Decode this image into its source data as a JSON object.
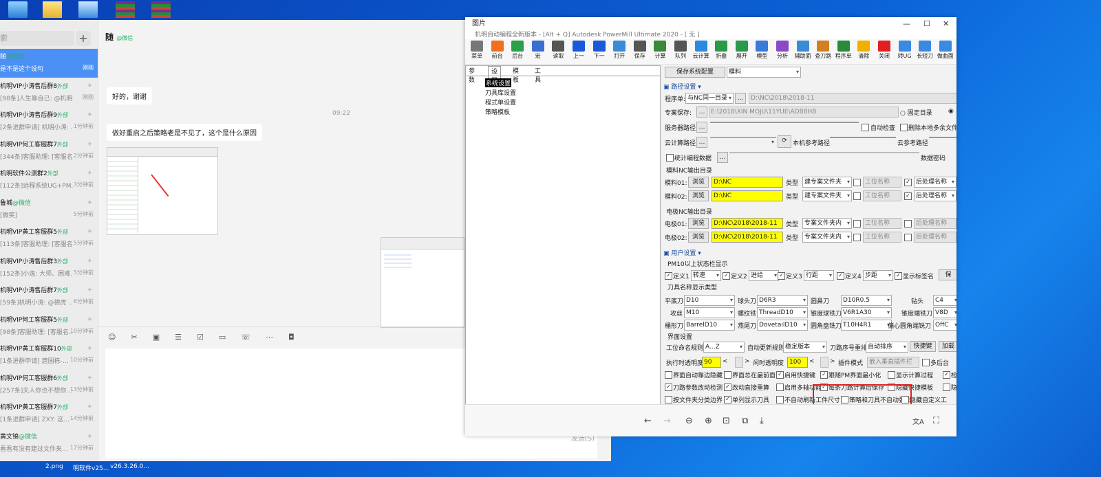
{
  "chat": {
    "search_placeholder": "索",
    "add": "+",
    "header_name": "随",
    "header_tag": "@微信",
    "conversations": [
      {
        "name": "随",
        "tag": "@微信",
        "preview": "是不是这个设句",
        "time": "刚刚",
        "active": true
      },
      {
        "name": "机明VIP小涛售后群8",
        "tag": "外部",
        "preview": "[98条]人生靠自己: @机明小…",
        "time": "刚刚"
      },
      {
        "name": "机明VIP小涛售后群9",
        "tag": "外部",
        "preview": "[2条进群申请] 机明小涛: …",
        "time": "1分钟前",
        "redpre": true
      },
      {
        "name": "机明VIP何工客服群7",
        "tag": "外部",
        "preview": "[344条]客服助理: [客服名…",
        "time": "2分钟前"
      },
      {
        "name": "机明软件公测群2",
        "tag": "外部",
        "preview": "[112条]远程系统UG+PM…",
        "time": "3分钟前"
      },
      {
        "name": "鲁城",
        "tag": "@微信",
        "preview": "[微笑]",
        "time": "5分钟前"
      },
      {
        "name": "机明VIP黄工客服群5",
        "tag": "外部",
        "preview": "[113条]客服助理: [客服名…",
        "time": "5分钟前"
      },
      {
        "name": "机明VIP小涛售后群3",
        "tag": "外部",
        "preview": "[152条]小逸: 大师、困难…",
        "time": "5分钟前"
      },
      {
        "name": "机明VIP小涛售后群7",
        "tag": "外部",
        "preview": "[59条]机明小涛: @德虎 …",
        "time": "6分钟前"
      },
      {
        "name": "机明VIP何工客服群5",
        "tag": "外部",
        "preview": "[98条]客服助理: [客服名…",
        "time": "10分钟前"
      },
      {
        "name": "机明VIP黄工客服群10",
        "tag": "外部",
        "preview": "[1条进群申请] 唐国栋-…",
        "time": "10分钟前",
        "redpre": true
      },
      {
        "name": "机明VIP何工客服群6",
        "tag": "外部",
        "preview": "[257条]夫人你也不想你…",
        "time": "13分钟前"
      },
      {
        "name": "机明VIP黄工客服群7",
        "tag": "外部",
        "preview": "[1条进群申请] ZXY: 这…",
        "time": "14分钟前",
        "redpre": true
      },
      {
        "name": "黄文锦",
        "tag": "@微信",
        "preview": "看看有没有建过文件夹…",
        "time": "17分钟前"
      }
    ],
    "messages": {
      "m1": "好的，谢谢",
      "time": "09:22",
      "m2": "做好重启之后策略老是不见了，这个是什么原因"
    },
    "send": "发送(S)",
    "strip": [
      "2.png",
      "明软件v25...",
      "v26.3.26.0..."
    ]
  },
  "dialog": {
    "title": "图片",
    "caption": "机明自动编程全新版本 - [Alt + Q] Autodesk PowerMill Ultimate 2020 - [ 无 ]",
    "ribbon": [
      "菜单",
      "前台",
      "后台",
      "宏",
      "读取",
      "上一",
      "下一",
      "打开",
      "保存",
      "计算",
      "队列",
      "云计算",
      "折叠",
      "展开",
      "模型",
      "分析",
      "辅助面",
      "查刀路",
      "程序单",
      "清除",
      "关闭",
      "转UG",
      "长短刀",
      "做曲面"
    ],
    "tabs": [
      "参数",
      "设置",
      "模板",
      "工具"
    ],
    "tree": [
      "系统设置",
      "刀具库设置",
      "程式单设置",
      "策略模板"
    ],
    "top": {
      "save_btn": "保存系统配置",
      "dropdown": "模料"
    },
    "path_section": "路径设置",
    "user_section": "用户设置",
    "labels": {
      "program": "程序单:",
      "program_sel": "与NC同一目录",
      "program_path": "D:\\NC\\2018\\2018-11",
      "archive": "专案保存:",
      "archive_path": "E:\\2018\\XIN MOJU\\11YUE\\ADB8HB",
      "fixed": "固定目录",
      "server": "服务器路径:",
      "autocheck": "自动检查",
      "delete_extra": "删除本地多余文件",
      "cloud": "云计算路径:",
      "local_ref": "本机参考路径",
      "cloud_ref": "云参考路径",
      "stats": "统计编程数据",
      "db_pwd": "数据密码",
      "mold_nc": "模料NC输出目录",
      "mold01": "模料01:",
      "mold02": "模料02:",
      "browse": "浏览",
      "nc": "D:\\NC",
      "type": "类型",
      "build_folder": "建专案文件夹",
      "pos_name": "工位名称",
      "post_name": "后处理名称",
      "elec_nc": "电极NC输出目录",
      "elec01": "电极01:",
      "elec02": "电极02:",
      "elec_path": "D:\\NC\\2018\\2018-11",
      "in_folder": "专案文件夹内",
      "pm10": "PM10以上状态栏显示",
      "def1": "定义1",
      "def1v": "转速",
      "def2": "定义2",
      "def2v": "进给",
      "def3": "定义3",
      "def3v": "行距",
      "def4": "定义4",
      "def4v": "步距",
      "show_sig": "显示标签名",
      "save": "保",
      "toolname": "刀具名称显示类型",
      "flat": "平底刀",
      "flatv": "D10",
      "ball": "球头刀",
      "ballv": "D6R3",
      "bull": "圆鼻刀",
      "bullv": "D10R0.5",
      "drill": "钻头",
      "drillv": "C4",
      "tap": "攻丝",
      "tapv": "M10",
      "thread": "螺纹铣",
      "threadv": "ThreadD10",
      "taperball": "锥度球铣刀",
      "taperballv": "V6R1A30",
      "taperend": "锥度端铣刀",
      "taperendv": "V8D",
      "barrel": "桶形刀",
      "barrelv": "BarrelD10",
      "dove": "燕尾刀",
      "dovev": "DovetailD10",
      "tslot": "圆角盘铣刀",
      "tslotv": "T10H4R1",
      "offset": "偏心圆角端铣刀",
      "offsetv": "OffC",
      "ui": "界面设置",
      "pos_rule": "工位命名规则",
      "pos_rule_v": "A...Z",
      "auto_update": "自动更新规则",
      "auto_update_v": "稳定版本",
      "tool_order": "刀路序号重排",
      "tool_order_v": "自动排序",
      "shortcut": "快捷键",
      "add": "加载",
      "exec_alpha": "执行时透明度",
      "exec_alpha_v": "90",
      "idle_alpha": "闲时透明度",
      "idle_alpha_v": "100",
      "plugin": "插件模式",
      "plugin_v": "嵌入垂直插件栏",
      "multi": "多后台",
      "c1": "界面自动靠边隐藏",
      "c2": "界面总在最前面",
      "c3": "启用快捷键",
      "c4": "跟随PM界面最小化",
      "c5": "显示计算过程",
      "c6": "检",
      "c7": "刀路参数改动检测",
      "c8": "改动直接重算",
      "c9": "启用多轴功能",
      "c10": "每条刀路计算后保存",
      "c11": "隐藏快捷模板",
      "c12": "隐",
      "c13": "按文件夹分类边界",
      "c14": "单列显示刀具",
      "c15": "不自动刷新工件尺寸",
      "c16": "策略和刀具不自动弹出",
      "c17": "隐藏自定义工"
    },
    "bottom": [
      "←",
      "→",
      "⊖",
      "⊕",
      "⊡",
      "⧉",
      "⤓",
      "文A",
      "⛶"
    ]
  }
}
